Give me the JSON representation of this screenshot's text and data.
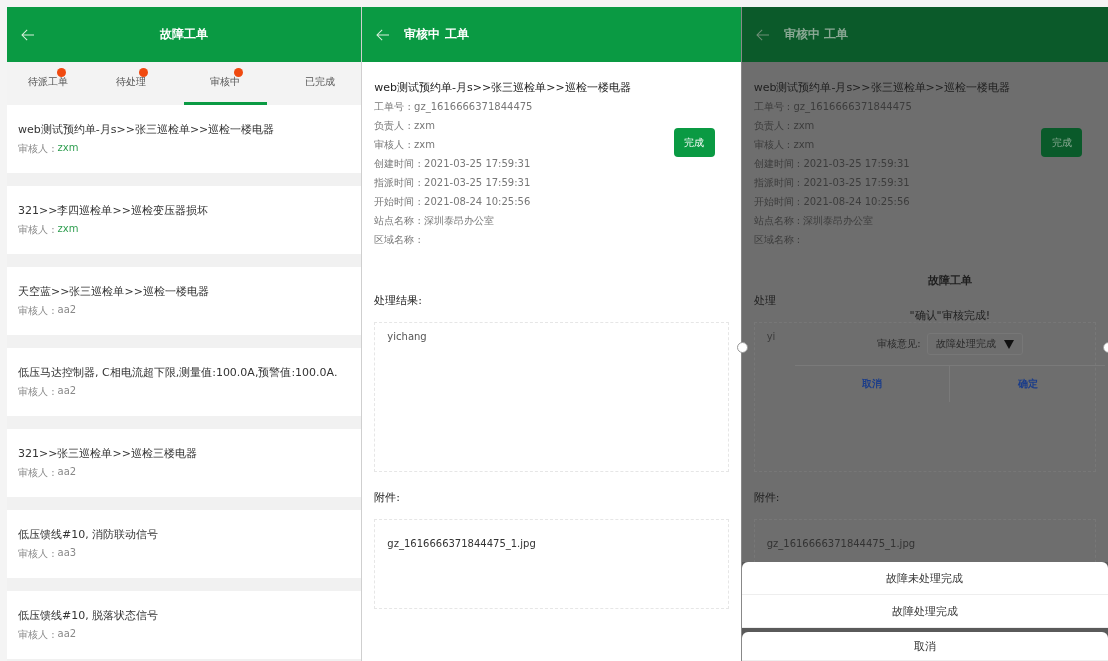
{
  "list_screen": {
    "title": "故障工单",
    "tabs": [
      {
        "label": "待派工单",
        "badge": true,
        "selected": false
      },
      {
        "label": "待处理",
        "badge": true,
        "selected": false
      },
      {
        "label": "审核中",
        "badge": true,
        "selected": true
      },
      {
        "label": "已完成",
        "badge": false,
        "selected": false
      }
    ],
    "orders": [
      {
        "title": "web测试预约单-月s>>张三巡检单>>巡检一楼电器",
        "reviewer_label": "审核人 :",
        "reviewer": "zxm",
        "color": "#2e9e4f"
      },
      {
        "title": "321>>李四巡检单>>巡检变压器损坏",
        "reviewer_label": "审核人 :",
        "reviewer": "zxm",
        "color": "#2e9e4f"
      },
      {
        "title": "天空蓝>>张三巡检单>>巡检一楼电器",
        "reviewer_label": "审核人 :",
        "reviewer": "aa2",
        "color": "#888888"
      },
      {
        "title": "低压马达控制器, C相电流超下限,测量值:100.0A,预警值:100.0A.",
        "reviewer_label": "审核人 :",
        "reviewer": "aa2",
        "color": "#888888"
      },
      {
        "title": "321>>张三巡检单>>巡检三楼电器",
        "reviewer_label": "审核人 :",
        "reviewer": "aa2",
        "color": "#888888"
      },
      {
        "title": "低压馈线#10, 消防联动信号",
        "reviewer_label": "审核人 :",
        "reviewer": "aa3",
        "color": "#888888"
      },
      {
        "title": "低压馈线#10, 脱落状态信号",
        "reviewer_label": "审核人 :",
        "reviewer": "aa2",
        "color": "#888888"
      }
    ]
  },
  "detail_screen": {
    "title": "审核中 工单",
    "heading": "web测试预约单-月s>>张三巡检单>>巡检一楼电器",
    "fields": [
      "工单号 : gz_1616666371844475",
      "负责人 : zxm",
      "审核人 : zxm",
      "创建时间 : 2021-03-25 17:59:31",
      "指派时间 : 2021-03-25 17:59:31",
      "开始时间 : 2021-08-24 10:25:56",
      "站点名称 : 深圳泰昂办公室",
      "区域名称 :"
    ],
    "complete_button": "完成",
    "result_label": "处理结果:",
    "result_text": "yichang",
    "attachment_label": "附件:",
    "attachment": "gz_1616666371844475_1.jpg"
  },
  "dialog_screen": {
    "title": "审核中 工单",
    "heading": "web测试预约单-月s>>张三巡检单>>巡检一楼电器",
    "fields": [
      "工单号 : gz_1616666371844475",
      "负责人 : zxm",
      "审核人 : zxm",
      "创建时间 : 2021-03-25 17:59:31",
      "指派时间 : 2021-03-25 17:59:31",
      "开始时间 : 2021-08-24 10:25:56",
      "站点名称 : 深圳泰昂办公室",
      "区域名称 :"
    ],
    "complete_button": "完成",
    "result_label": "处理",
    "result_text": "yi",
    "attachment_label": "附件:",
    "attachment": "gz_1616666371844475_1.jpg",
    "dialog": {
      "title": "故障工单",
      "message": "\"确认\"审核完成!",
      "opinion_label": "审核意见:",
      "opinion_value": "故障处理完成",
      "cancel": "取消",
      "confirm": "确定"
    },
    "action_sheet": {
      "options": [
        "故障未处理完成",
        "故障处理完成"
      ],
      "cancel": "取消"
    }
  }
}
